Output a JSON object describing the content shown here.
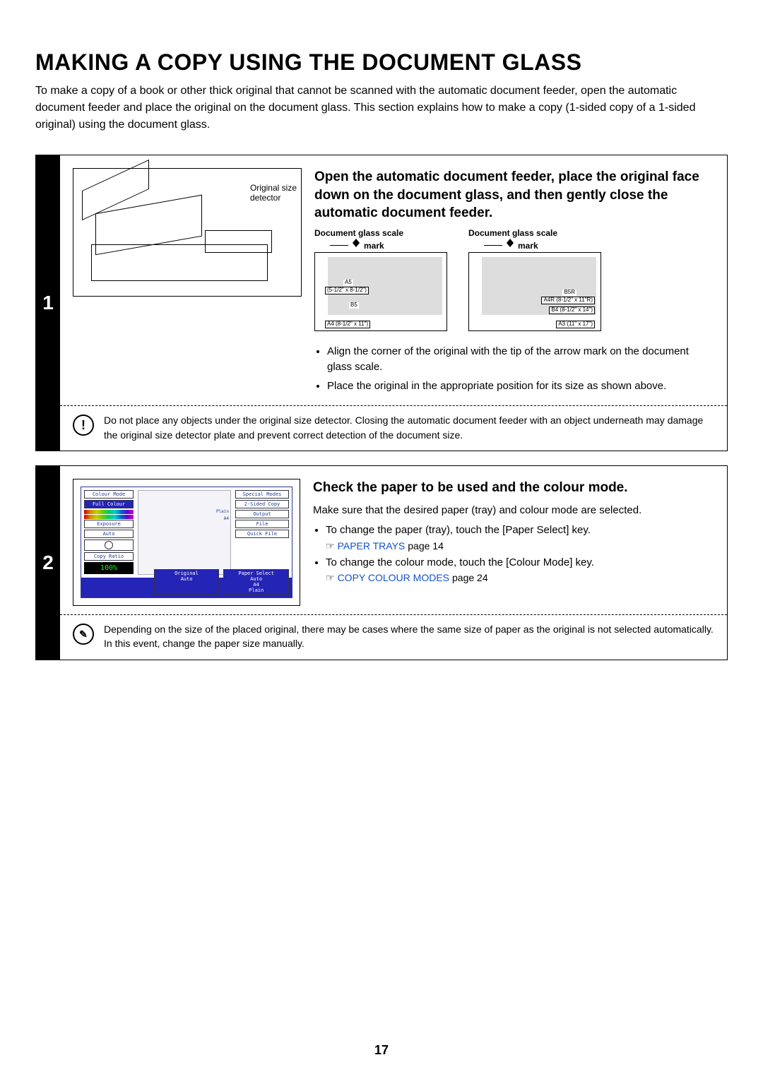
{
  "title": "MAKING A COPY USING THE DOCUMENT GLASS",
  "intro": "To make a copy of a book or other thick original that cannot be scanned with the automatic document feeder, open the automatic document feeder and place the original on the document glass. This section explains how to make a copy (1-sided copy of a 1-sided original) using the document glass.",
  "step1": {
    "num": "1",
    "illus_label1": "Original size",
    "illus_label2": "detector",
    "heading": "Open the automatic document feeder, place the original face down on the document glass, and then gently close the automatic document feeder.",
    "scale_title": "Document glass scale",
    "mark_label": "mark",
    "scaleA": {
      "a5": "A5",
      "a5sub": "(5-1/2\" x 8-1/2\")",
      "b5": "B5",
      "a4": "A4 (8-1/2\" x 11\")"
    },
    "scaleB": {
      "b5r": "B5R",
      "a4r": "A4R (8-1/2\" x 11\"R)",
      "b4": "B4 (8-1/2\" x 14\")",
      "a3": "A3 (11\" x 17\")"
    },
    "bullet1": "Align the corner of the original with the tip of the arrow mark      on the document glass scale.",
    "bullet2": "Place the original in the appropriate position for its size as shown above.",
    "note": "Do not place any objects under the original size detector. Closing the automatic document feeder with an object underneath may damage the original size detector plate and prevent correct detection of the document size."
  },
  "step2": {
    "num": "2",
    "heading": "Check the paper to be used and the colour mode.",
    "body": "Make sure that the desired paper (tray) and colour mode are selected.",
    "li1": "To change the paper (tray), touch the [Paper Select] key.",
    "xref1_link": "PAPER TRAYS",
    "xref1_rest": " page 14",
    "li2": "To change the colour mode, touch the [Colour Mode] key.",
    "xref2_link": "COPY COLOUR MODES",
    "xref2_rest": " page 24",
    "note": "Depending on the size of the placed original, there may be cases where the same size of paper as the original is not selected automatically. In this event, change the paper size manually.",
    "panel": {
      "colour_mode": "Colour Mode",
      "full_colour": "Full Colour",
      "exposure": "Exposure",
      "auto": "Auto",
      "copy_ratio": "Copy Ratio",
      "ratio": "100%",
      "original": "Original",
      "paper_select": "Paper Select",
      "a4": "A4",
      "plain": "Plain",
      "special": "Special Modes",
      "two_sided": "2-Sided Copy",
      "output": "Output",
      "file": "File",
      "quick_file": "Quick File"
    }
  },
  "page_number": "17"
}
